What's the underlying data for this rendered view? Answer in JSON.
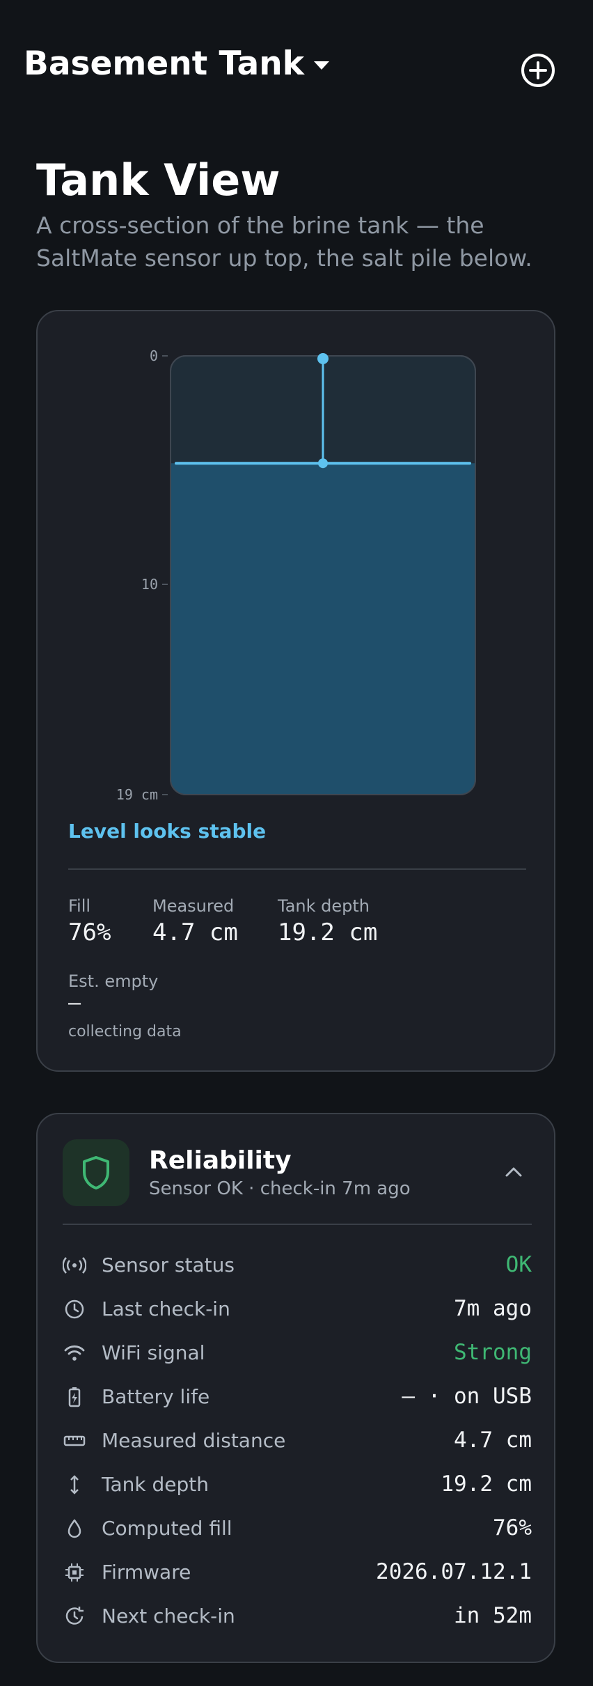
{
  "header": {
    "tank_name": "Basement Tank",
    "add_icon": "plus-circle-icon",
    "caret_icon": "caret-down-icon"
  },
  "page": {
    "title": "Tank View",
    "subtitle": "A cross-section of the brine tank — the SaltMate sensor up top, the salt pile below."
  },
  "tank_view": {
    "ticks": [
      "0",
      "10",
      "19 cm"
    ],
    "status": "Level looks stable",
    "stats": {
      "fill_label": "Fill",
      "fill_value": "76%",
      "measured_label": "Measured",
      "measured_value": "4.7 cm",
      "depth_label": "Tank depth",
      "depth_value": "19.2 cm",
      "empty_label": "Est. empty",
      "empty_value": "—",
      "empty_note": "collecting data"
    },
    "colors": {
      "accent": "#5ec2ef",
      "salt_fill": "#1f4f6b",
      "air": "#1f2d38"
    }
  },
  "chart_data": {
    "type": "area",
    "title": "",
    "axis": "depth",
    "ylim": [
      0,
      19.2
    ],
    "y_ticks": [
      0,
      10,
      19
    ],
    "y_tick_labels": [
      "0",
      "10",
      "19 cm"
    ],
    "sensor_distance_cm": 4.7,
    "tank_depth_cm": 19.2,
    "fill_percent": 76
  },
  "reliability": {
    "title": "Reliability",
    "subtitle": "Sensor OK · check-in 7m ago",
    "icon": "shield-icon",
    "collapse_icon": "chevron-up-icon",
    "rows": [
      {
        "icon": "broadcast-icon",
        "label": "Sensor status",
        "value": "OK",
        "status": "good"
      },
      {
        "icon": "clock-icon",
        "label": "Last check-in",
        "value": "7m ago"
      },
      {
        "icon": "wifi-icon",
        "label": "WiFi signal",
        "value": "Strong",
        "status": "good"
      },
      {
        "icon": "battery-icon",
        "label": "Battery life",
        "value": "— · on USB"
      },
      {
        "icon": "ruler-icon",
        "label": "Measured distance",
        "value": "4.7 cm"
      },
      {
        "icon": "vertical-arrows-icon",
        "label": "Tank depth",
        "value": "19.2 cm"
      },
      {
        "icon": "droplet-icon",
        "label": "Computed fill",
        "value": "76%"
      },
      {
        "icon": "chip-icon",
        "label": "Firmware",
        "value": "2026.07.12.1"
      },
      {
        "icon": "refresh-clock-icon",
        "label": "Next check-in",
        "value": "in 52m"
      }
    ],
    "colors": {
      "good": "#3fb874",
      "icon_bg": "#1e3328"
    }
  }
}
